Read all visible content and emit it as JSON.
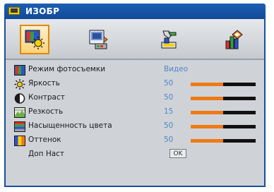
{
  "window": {
    "title": "ИЗОБР"
  },
  "tabs": [
    {
      "icon": "image-settings-icon",
      "active": true
    },
    {
      "icon": "display-screen-icon",
      "active": false
    },
    {
      "icon": "setup-tools-icon",
      "active": false
    },
    {
      "icon": "options-chart-icon",
      "active": false
    }
  ],
  "rows": [
    {
      "label": "Режим фотосъемки",
      "value": "Видео",
      "icon": "color-mode-icon"
    },
    {
      "label": "Яркость",
      "value": "50",
      "level": 0.5,
      "icon": "brightness-icon"
    },
    {
      "label": "Контраст",
      "value": "50",
      "level": 0.5,
      "icon": "contrast-icon"
    },
    {
      "label": "Резкость",
      "value": "15",
      "level": 0.5,
      "icon": "sharpness-icon"
    },
    {
      "label": "Насыщенность цвета",
      "value": "50",
      "level": 0.5,
      "icon": "saturation-icon"
    },
    {
      "label": "Оттенок",
      "value": "50",
      "level": 0.5,
      "icon": "tint-icon"
    },
    {
      "label": "Доп Наст",
      "button": "OK"
    }
  ],
  "colors": {
    "title_bar": "#1c5fb4",
    "value_text": "#4f86c6",
    "slider_fill": "#f07a12",
    "active_tab_border": "#e08a00"
  }
}
